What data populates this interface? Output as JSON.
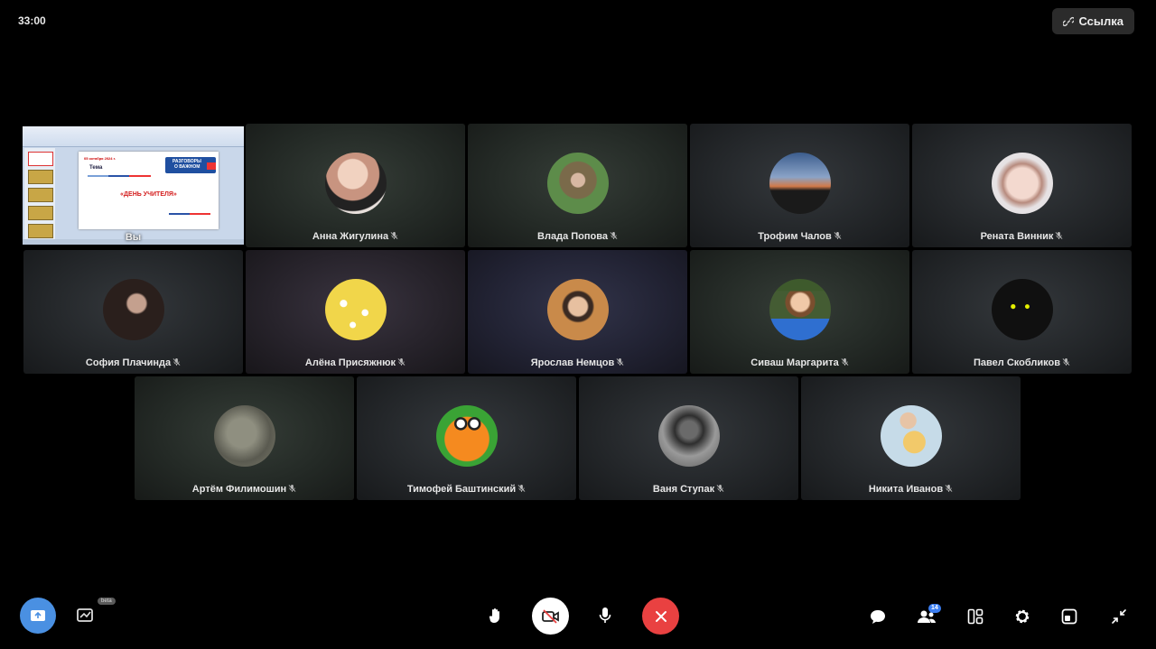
{
  "call": {
    "timer": "33:00",
    "link_label": "Ссылка"
  },
  "screen_share": {
    "you_label": "Вы",
    "slide_date": "05 октября 2024 г.",
    "slide_topic_label": "Тема",
    "slide_logo_line1": "РАЗГОВОРЫ",
    "slide_logo_line2": "О ВАЖНОМ",
    "slide_title": "«ДЕНЬ УЧИТЕЛЯ»"
  },
  "participants": [
    {
      "name": "Анна Жигулина"
    },
    {
      "name": "Влада Попова"
    },
    {
      "name": "Трофим Чалов"
    },
    {
      "name": "Рената Винник"
    },
    {
      "name": "София Плачинда"
    },
    {
      "name": "Алёна Присяжнюк"
    },
    {
      "name": "Ярослав Немцов"
    },
    {
      "name": "Сиваш Маргарита"
    },
    {
      "name": "Павел Скобликов"
    },
    {
      "name": "Артём Филимошин"
    },
    {
      "name": "Тимофей Баштинский"
    },
    {
      "name": "Ваня Ступак"
    },
    {
      "name": "Никита Иванов"
    }
  ],
  "toolbar": {
    "beta_label": "beta",
    "participants_count": "14",
    "colors": {
      "share_button": "#4a90e2",
      "end_call_button": "#e94141",
      "badge": "#3b7ef2"
    }
  }
}
